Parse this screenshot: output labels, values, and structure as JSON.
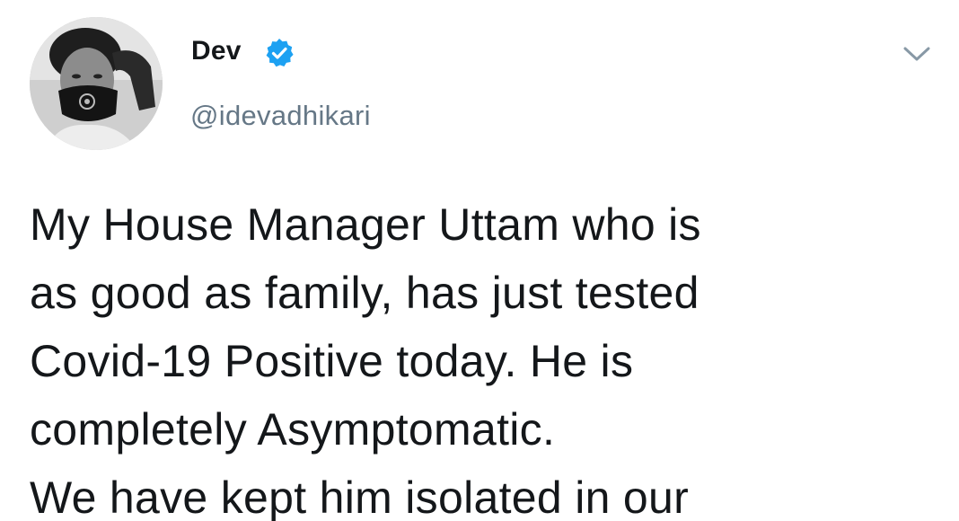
{
  "user": {
    "display_name": "Dev",
    "handle": "@idevadhikari",
    "verified": true,
    "avatar_icon": "profile-photo"
  },
  "tweet": {
    "lines": [
      "My House Manager Uttam who is",
      "as good as family, has just tested",
      "Covid-19 Positive today. He is",
      "completely Asymptomatic.",
      "We have kept him isolated in our"
    ]
  },
  "icons": {
    "verified": "verified-badge-icon",
    "more": "chevron-down-icon"
  },
  "colors": {
    "verified_blue": "#1da1f2",
    "text_primary": "#14171a",
    "text_secondary": "#657786",
    "chevron_gray": "#8899a6"
  }
}
